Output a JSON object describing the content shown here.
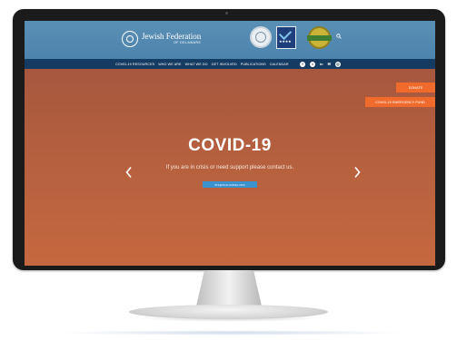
{
  "header": {
    "brand": {
      "name": "Jewish Federation",
      "sub": "OF DELAWARE"
    },
    "badges": [
      "seal-badge",
      "charity-navigator-badge",
      "seal-of-transparency-badge"
    ]
  },
  "nav": {
    "items": [
      "COVID-19 RESOURCES",
      "WHO WE ARE",
      "WHAT WE DO",
      "GET INVOLVED",
      "PUBLICATIONS",
      "CALENDAR"
    ],
    "socials": [
      "facebook-icon",
      "twitter-icon",
      "linkedin-icon",
      "email-icon",
      "instagram-icon"
    ]
  },
  "hero": {
    "donate": "DONATE",
    "emergency": "COVID-19 EMERGENCY FUND",
    "title": "COVID-19",
    "subtitle": "If you are in crisis or need support please contact us.",
    "button": "JFS@SHALOMDEL.ORG"
  },
  "colors": {
    "header_blue": "#4d84ad",
    "nav_navy": "#163b63",
    "hero_orange": "#b5603f",
    "accent_orange": "#f06a2c",
    "button_blue": "#3a92cf"
  }
}
